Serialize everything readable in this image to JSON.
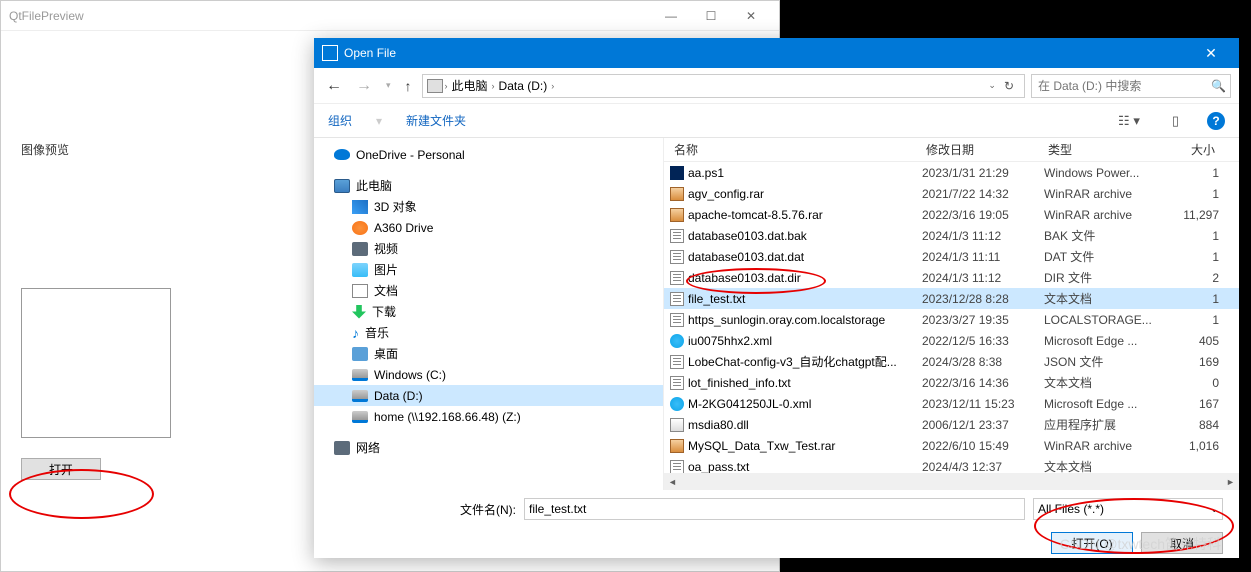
{
  "qt": {
    "title": "QtFilePreview",
    "label": "图像预览",
    "open_btn": "打开"
  },
  "dialog": {
    "title": "Open File",
    "breadcrumbs": {
      "pc": "此电脑",
      "drive": "Data (D:)"
    },
    "search_placeholder": "在 Data (D:) 中搜索",
    "organize": "组织",
    "newfolder": "新建文件夹",
    "tree": {
      "onedrive": "OneDrive - Personal",
      "pc": "此电脑",
      "obj3d": "3D 对象",
      "a360": "A360 Drive",
      "video": "视频",
      "pic": "图片",
      "docs": "文档",
      "down": "下载",
      "music": "音乐",
      "desk": "桌面",
      "winc": "Windows (C:)",
      "datad": "Data (D:)",
      "home": "home (\\\\192.168.66.48) (Z:)",
      "net": "网络"
    },
    "columns": {
      "name": "名称",
      "date": "修改日期",
      "type": "类型",
      "size": "大小"
    },
    "files": [
      {
        "icon": "ps1",
        "name": "aa.ps1",
        "date": "2023/1/31 21:29",
        "type": "Windows Power...",
        "size": "1"
      },
      {
        "icon": "rar",
        "name": "agv_config.rar",
        "date": "2021/7/22 14:32",
        "type": "WinRAR archive",
        "size": "1"
      },
      {
        "icon": "rar",
        "name": "apache-tomcat-8.5.76.rar",
        "date": "2022/3/16 19:05",
        "type": "WinRAR archive",
        "size": "11,297"
      },
      {
        "icon": "txt",
        "name": "database0103.dat.bak",
        "date": "2024/1/3 11:12",
        "type": "BAK 文件",
        "size": "1"
      },
      {
        "icon": "txt",
        "name": "database0103.dat.dat",
        "date": "2024/1/3 11:11",
        "type": "DAT 文件",
        "size": "1"
      },
      {
        "icon": "txt",
        "name": "database0103.dat.dir",
        "date": "2024/1/3 11:12",
        "type": "DIR 文件",
        "size": "2"
      },
      {
        "icon": "txt",
        "name": "file_test.txt",
        "date": "2023/12/28 8:28",
        "type": "文本文档",
        "size": "1",
        "selected": true
      },
      {
        "icon": "txt",
        "name": "https_sunlogin.oray.com.localstorage",
        "date": "2023/3/27 19:35",
        "type": "LOCALSTORAGE...",
        "size": "1"
      },
      {
        "icon": "edge",
        "name": "iu0075hhx2.xml",
        "date": "2022/12/5 16:33",
        "type": "Microsoft Edge ...",
        "size": "405"
      },
      {
        "icon": "txt",
        "name": "LobeChat-config-v3_自动化chatgpt配...",
        "date": "2024/3/28 8:38",
        "type": "JSON 文件",
        "size": "169"
      },
      {
        "icon": "txt",
        "name": "lot_finished_info.txt",
        "date": "2022/3/16 14:36",
        "type": "文本文档",
        "size": "0"
      },
      {
        "icon": "edge",
        "name": "M-2KG041250JL-0.xml",
        "date": "2023/12/11 15:23",
        "type": "Microsoft Edge ...",
        "size": "167"
      },
      {
        "icon": "dll",
        "name": "msdia80.dll",
        "date": "2006/12/1 23:37",
        "type": "应用程序扩展",
        "size": "884"
      },
      {
        "icon": "rar",
        "name": "MySQL_Data_Txw_Test.rar",
        "date": "2022/6/10 15:49",
        "type": "WinRAR archive",
        "size": "1,016"
      },
      {
        "icon": "txt",
        "name": "oa_pass.txt",
        "date": "2024/4/3 12:37",
        "type": "文本文档",
        "size": ""
      }
    ],
    "file_label": "文件名(N):",
    "file_value": "file_test.txt",
    "filter": "All Files (*.*)",
    "open": "打开(O)",
    "cancel": "取消"
  },
  "watermark": "CSDN @txwtech笛克特科"
}
